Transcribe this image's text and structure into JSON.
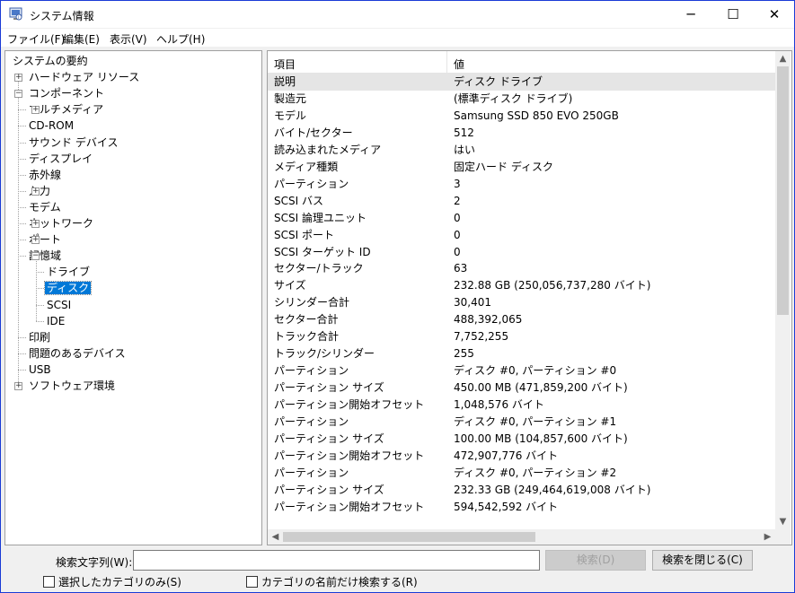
{
  "window": {
    "title": "システム情報",
    "minimize_icon": "─",
    "maximize_icon": "☐",
    "close_icon": "✕",
    "accent": "#1a3bd6"
  },
  "menu": [
    "ファイル(F)",
    "編集(E)",
    "表示(V)",
    "ヘルプ(H)"
  ],
  "tree": [
    {
      "label": "システムの要約",
      "expander": ""
    },
    {
      "label": "ハードウェア リソース",
      "expander": "+"
    },
    {
      "label": "コンポーネント",
      "expander": "−"
    },
    {
      "label": "マルチメディア",
      "expander": "+"
    },
    {
      "label": "CD-ROM",
      "expander": ""
    },
    {
      "label": "サウンド デバイス",
      "expander": ""
    },
    {
      "label": "ディスプレイ",
      "expander": ""
    },
    {
      "label": "赤外線",
      "expander": ""
    },
    {
      "label": "入力",
      "expander": "+"
    },
    {
      "label": "モデム",
      "expander": ""
    },
    {
      "label": "ネットワーク",
      "expander": "+"
    },
    {
      "label": "ポート",
      "expander": "+"
    },
    {
      "label": "記憶域",
      "expander": "−"
    },
    {
      "label": "ドライブ",
      "expander": ""
    },
    {
      "label": "ディスク",
      "expander": "",
      "selected": true
    },
    {
      "label": "SCSI",
      "expander": ""
    },
    {
      "label": "IDE",
      "expander": ""
    },
    {
      "label": "印刷",
      "expander": ""
    },
    {
      "label": "問題のあるデバイス",
      "expander": ""
    },
    {
      "label": "USB",
      "expander": ""
    },
    {
      "label": "ソフトウェア環境",
      "expander": "+"
    }
  ],
  "table": {
    "columns": [
      "項目",
      "値"
    ],
    "rows": [
      [
        "説明",
        "ディスク ドライブ"
      ],
      [
        "製造元",
        "(標準ディスク ドライブ)"
      ],
      [
        "モデル",
        "Samsung SSD 850 EVO 250GB"
      ],
      [
        "バイト/セクター",
        "512"
      ],
      [
        "読み込まれたメディア",
        "はい"
      ],
      [
        "メディア種類",
        "固定ハード ディスク"
      ],
      [
        "パーティション",
        "3"
      ],
      [
        "SCSI バス",
        "2"
      ],
      [
        "SCSI 論理ユニット",
        "0"
      ],
      [
        "SCSI ポート",
        "0"
      ],
      [
        "SCSI ターゲット ID",
        "0"
      ],
      [
        "セクター/トラック",
        "63"
      ],
      [
        "サイズ",
        "232.88 GB (250,056,737,280 バイト)"
      ],
      [
        "シリンダー合計",
        "30,401"
      ],
      [
        "セクター合計",
        "488,392,065"
      ],
      [
        "トラック合計",
        "7,752,255"
      ],
      [
        "トラック/シリンダー",
        "255"
      ],
      [
        "パーティション",
        "ディスク #0, パーティション #0"
      ],
      [
        "パーティション サイズ",
        "450.00 MB (471,859,200 バイト)"
      ],
      [
        "パーティション開始オフセット",
        "1,048,576 バイト"
      ],
      [
        "パーティション",
        "ディスク #0, パーティション #1"
      ],
      [
        "パーティション サイズ",
        "100.00 MB (104,857,600 バイト)"
      ],
      [
        "パーティション開始オフセット",
        "472,907,776 バイト"
      ],
      [
        "パーティション",
        "ディスク #0, パーティション #2"
      ],
      [
        "パーティション サイズ",
        "232.33 GB (249,464,619,008 バイト)"
      ],
      [
        "パーティション開始オフセット",
        "594,542,592 バイト"
      ]
    ]
  },
  "search": {
    "label": "検索文字列(W):",
    "value": "",
    "search_button": "検索(D)",
    "close_button": "検索を閉じる(C)",
    "selected_category_only": "選択したカテゴリのみ(S)",
    "category_names_only": "カテゴリの名前だけ検索する(R)"
  }
}
